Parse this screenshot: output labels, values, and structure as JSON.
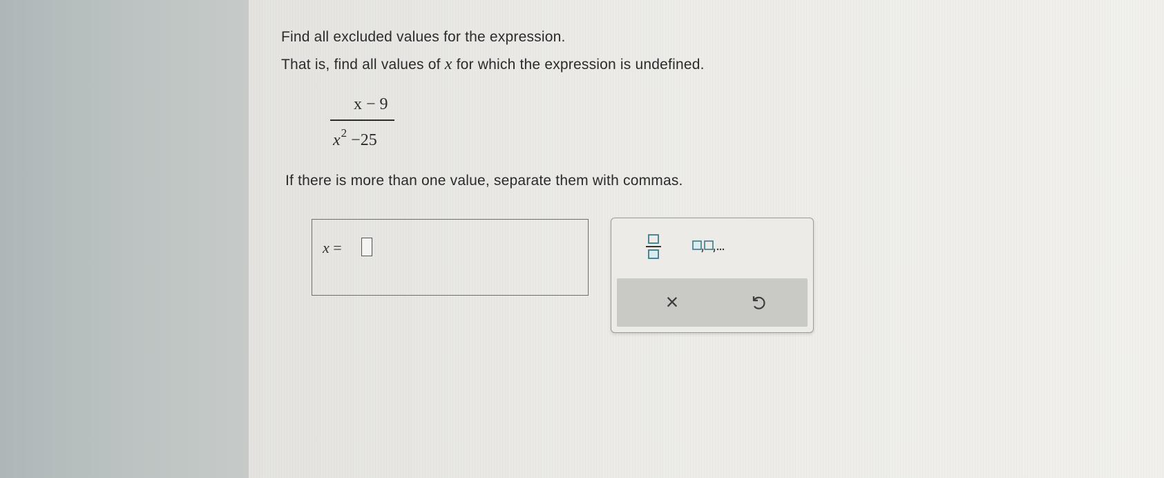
{
  "question": {
    "line1": "Find all excluded values for the expression.",
    "line2_before_var": "That is, find all values of",
    "line2_var": "x",
    "line2_after_var": "for which the expression is undefined.",
    "expression": {
      "numerator": "x − 9",
      "denominator_var": "x",
      "denominator_exponent": "2",
      "denominator_rest": "−25"
    },
    "instruction": "If there is more than one value, separate them with commas."
  },
  "answer": {
    "variable": "x",
    "equals": "=",
    "value": ""
  },
  "toolbar": {
    "fraction_icon": "fraction-template-icon",
    "list_icon": "comma-list-template-icon",
    "list_label": "□,□,...",
    "clear_label": "×",
    "undo_icon": "undo-icon"
  },
  "colors": {
    "text": "#2b2b2b",
    "toolbar_action_bg": "#c9c9c6",
    "icon_accent": "#3a7a8a"
  }
}
